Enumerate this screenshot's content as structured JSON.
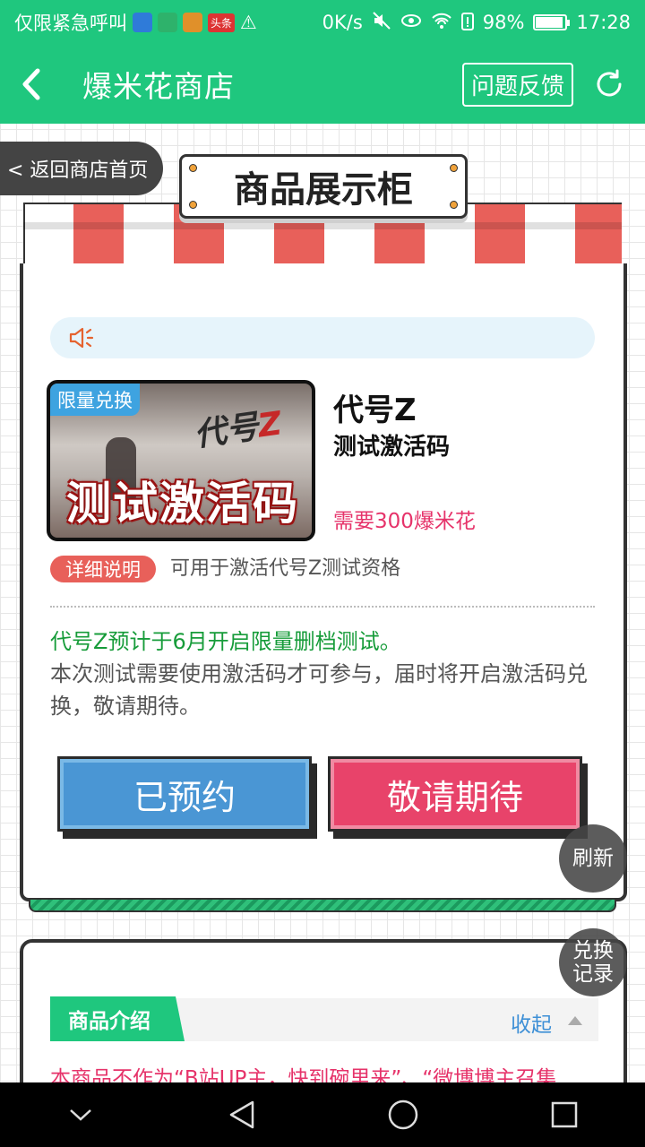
{
  "status_bar": {
    "carrier": "仅限紧急呼叫",
    "app_icon_toutiao": "头条",
    "speed": "0K/s",
    "battery_pct": "98%",
    "time": "17:28"
  },
  "app_bar": {
    "title": "爆米花商店",
    "feedback_label": "问题反馈"
  },
  "back_home_label": "< 返回商店首页",
  "sign_title": "商品展示柜",
  "product": {
    "badge": "限量兑换",
    "image_logo_text": "代号",
    "image_logo_z": "Z",
    "image_text": "测试激活码",
    "name": "代号Z",
    "subtitle": "测试激活码",
    "price": "需要300爆米花",
    "detail_tag": "详细说明",
    "detail_text": "可用于激活代号Z测试资格",
    "desc_highlight": "代号Z预计于6月开启限量删档测试。",
    "desc_body": "本次测试需要使用激活码才可参与，届时将开启激活码兑换，敬请期待。"
  },
  "buttons": {
    "reserved": "已预约",
    "coming_soon": "敬请期待"
  },
  "floats": {
    "refresh": "刷新",
    "exchange_records": "兑换\n记录"
  },
  "intro": {
    "tab": "商品介绍",
    "collapse": "收起",
    "note": "本商品不作为“B站UP主，快到碗里来”、“微博博主召集"
  },
  "colors": {
    "brand_green": "#1fc77e",
    "accent_red": "#e8436a",
    "accent_blue": "#4a96d4"
  }
}
